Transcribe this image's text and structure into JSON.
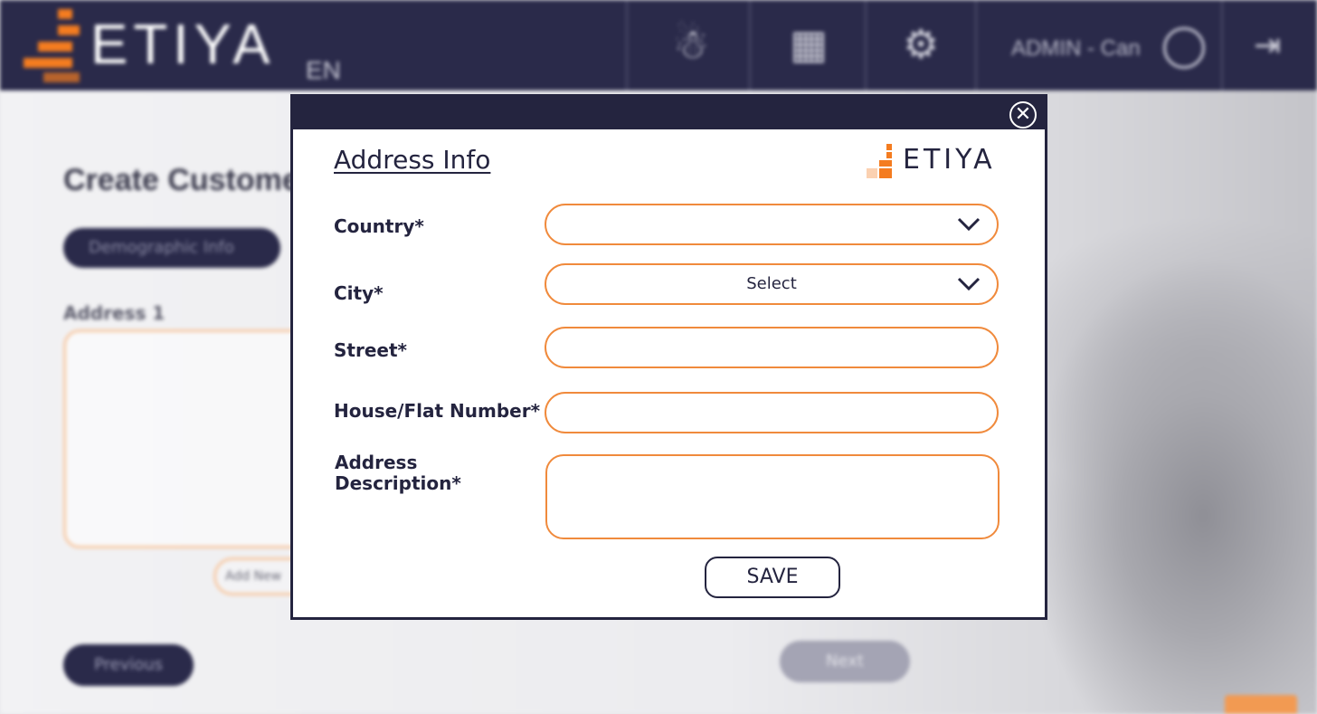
{
  "app": {
    "brand": "ETIYA",
    "language": "EN",
    "user": "ADMIN - Can"
  },
  "background": {
    "page_title": "Create Customer",
    "tab": "Demographic Info",
    "address_label": "Address 1",
    "add_new": "Add New",
    "previous_button": "Previous",
    "next_button": "Next"
  },
  "modal": {
    "title": "Address Info",
    "logo_text": "ETIYA",
    "close_symbol": "✕",
    "fields": {
      "country": {
        "label": "Country*",
        "value": ""
      },
      "city": {
        "label": "City*",
        "value": "Select"
      },
      "street": {
        "label": "Street*",
        "value": ""
      },
      "house": {
        "label": "House/Flat Number*",
        "value": ""
      },
      "description": {
        "label": "Address Description*",
        "value": ""
      }
    },
    "save_label": "SAVE"
  },
  "colors": {
    "navy": "#24243f",
    "accent": "#f08a3c",
    "brand_orange": "#f47c20"
  },
  "icons": [
    "close-icon",
    "chevron-down-icon",
    "etiya-logo-icon",
    "gear-icon",
    "user-icon",
    "logout-icon"
  ]
}
